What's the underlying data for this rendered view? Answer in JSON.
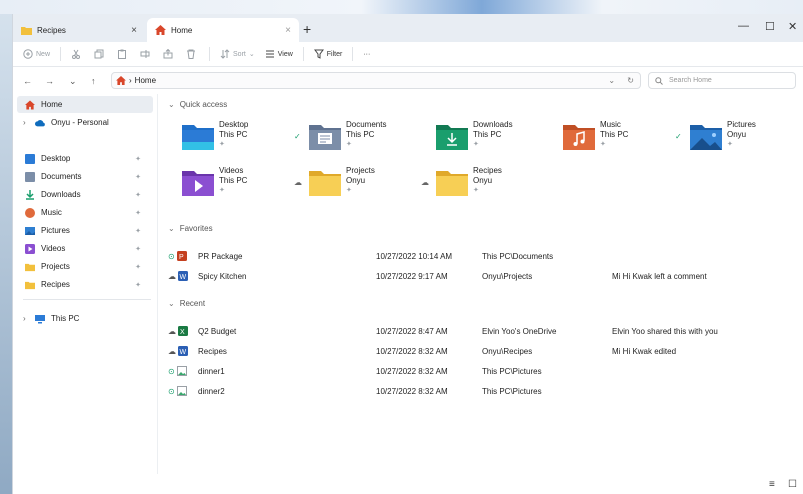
{
  "tabs": [
    {
      "label": "Recipes",
      "close": "×"
    },
    {
      "label": "Home",
      "close": "×"
    }
  ],
  "new_tab": "+",
  "window_controls": {
    "minimize": "—",
    "maximize": "☐",
    "close": "✕"
  },
  "toolbar": {
    "new_label": "New",
    "sort_label": "Sort",
    "view_label": "View",
    "filter_label": "Filter",
    "more_label": "···"
  },
  "address": {
    "back": "←",
    "forward": "→",
    "recent": "⌄",
    "up": "↑",
    "separator": "›",
    "crumb": "Home",
    "dropdown": "⌄",
    "refresh": "↻",
    "search_placeholder": "Search Home"
  },
  "nav": {
    "home": "Home",
    "onedrive": "Onyu - Personal",
    "quick": [
      {
        "label": "Desktop",
        "icon": "desktop-icon",
        "color": "#2b7bd6"
      },
      {
        "label": "Documents",
        "icon": "documents-icon",
        "color": "#7c8ea8"
      },
      {
        "label": "Downloads",
        "icon": "downloads-icon",
        "color": "#1a9e6d"
      },
      {
        "label": "Music",
        "icon": "music-icon",
        "color": "#e06a3b"
      },
      {
        "label": "Pictures",
        "icon": "pictures-icon",
        "color": "#2f7fd1"
      },
      {
        "label": "Videos",
        "icon": "videos-icon",
        "color": "#8b4fd1"
      },
      {
        "label": "Projects",
        "icon": "folder-icon",
        "color": "#f2c03c"
      },
      {
        "label": "Recipes",
        "icon": "folder-icon",
        "color": "#f2c03c"
      }
    ],
    "pin": "📌",
    "this_pc": "This PC"
  },
  "main": {
    "quick_access_label": "Quick access",
    "tiles": [
      {
        "name": "Desktop",
        "location": "This PC",
        "color": "#2b7bd6",
        "status": ""
      },
      {
        "name": "Documents",
        "location": "This PC",
        "color": "#7c8ea8",
        "status": "✓"
      },
      {
        "name": "Downloads",
        "location": "This PC",
        "color": "#1a9e6d",
        "status": ""
      },
      {
        "name": "Music",
        "location": "This PC",
        "color": "#e06a3b",
        "status": ""
      },
      {
        "name": "Pictures",
        "location": "Onyu",
        "color": "#2f7fd1",
        "status": "✓"
      },
      {
        "name": "Videos",
        "location": "This PC",
        "color": "#8b4fd1",
        "status": ""
      },
      {
        "name": "Projects",
        "location": "Onyu",
        "color": "#f2c03c",
        "status": "☁"
      },
      {
        "name": "Recipes",
        "location": "Onyu",
        "color": "#f2c03c",
        "status": "☁"
      }
    ],
    "favorites_label": "Favorites",
    "favorites": [
      {
        "name": "PR Package",
        "date": "10/27/2022 10:14 AM",
        "location": "This PC\\Documents",
        "activity": ""
      },
      {
        "name": "Spicy Kitchen",
        "date": "10/27/2022 9:17 AM",
        "location": "Onyu\\Projects",
        "activity": "Mi Hi Kwak left a comment"
      }
    ],
    "recent_label": "Recent",
    "recent": [
      {
        "name": "Q2 Budget",
        "date": "10/27/2022 8:47 AM",
        "location": "Elvin Yoo's OneDrive",
        "activity": "Elvin Yoo shared this with you"
      },
      {
        "name": "Recipes",
        "date": "10/27/2022 8:32 AM",
        "location": "Onyu\\Recipes",
        "activity": "Mi Hi Kwak edited"
      },
      {
        "name": "dinner1",
        "date": "10/27/2022 8:32 AM",
        "location": "This PC\\Pictures",
        "activity": ""
      },
      {
        "name": "dinner2",
        "date": "10/27/2022 8:32 AM",
        "location": "This PC\\Pictures",
        "activity": ""
      }
    ]
  },
  "statusbar": {
    "details_view": "≡",
    "tiles_view": "☐"
  }
}
